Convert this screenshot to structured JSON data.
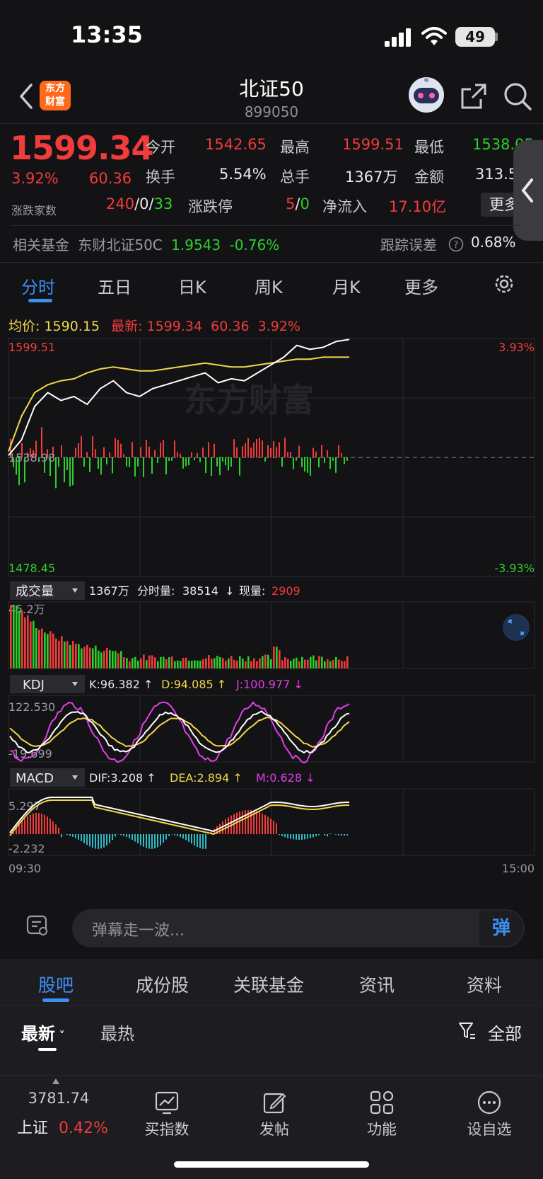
{
  "status_bar": {
    "time": "13:35",
    "battery": "49"
  },
  "header": {
    "logo": "东方\n财富",
    "title": "北证50",
    "code": "899050"
  },
  "quote": {
    "price": "1599.34",
    "change_pct": "3.92%",
    "change": "60.36",
    "open_label": "今开",
    "open": "1542.65",
    "high_label": "最高",
    "high": "1599.51",
    "low_label": "最低",
    "low": "1538.05",
    "turnover_label": "换手",
    "turnover": "5.54%",
    "volume_label": "总手",
    "volume": "1367万",
    "amount_label": "金额",
    "amount": "313.5",
    "adv_label": "涨跌家数",
    "adv_up": "240",
    "adv_sep1": "/",
    "adv_flat": "0",
    "adv_sep2": "/",
    "adv_down": "33",
    "limit_label": "涨跌停",
    "limit_up": "5",
    "limit_sep": "/",
    "limit_down": "0",
    "netflow_label": "净流入",
    "netflow": "17.10亿",
    "more": "更多"
  },
  "fund": {
    "label": "相关基金",
    "name": "东财北证50C",
    "price": "1.9543",
    "change": "-0.76%",
    "tracking_label": "跟踪误差",
    "tracking_value": "0.68%"
  },
  "chart_tabs": [
    "分时",
    "五日",
    "日K",
    "周K",
    "月K",
    "更多"
  ],
  "chart_data": {
    "type": "line",
    "series": [
      {
        "name": "最新",
        "values": [
          1540,
          1548,
          1565,
          1572,
          1568,
          1570,
          1566,
          1574,
          1578,
          1572,
          1570,
          1574,
          1576,
          1578,
          1580,
          1582,
          1577,
          1579,
          1578,
          1582,
          1586,
          1590,
          1596,
          1594,
          1595,
          1598,
          1599
        ]
      },
      {
        "name": "均价",
        "values": [
          1542,
          1560,
          1572,
          1576,
          1578,
          1579,
          1582,
          1584,
          1585,
          1584,
          1583,
          1583,
          1584,
          1585,
          1586,
          1587,
          1586,
          1585,
          1585,
          1586,
          1587,
          1588,
          1589,
          1589,
          1590,
          1590,
          1590
        ]
      }
    ],
    "ylim": [
      1478.45,
      1599.51
    ],
    "y_top_label": "1599.51",
    "y_mid_label": "1538.98",
    "y_bottom_label": "1478.45",
    "pct_top_label": "3.93%",
    "pct_bottom_label": "-3.93%",
    "x_start_label": "09:30",
    "x_end_label": "15:00",
    "watermark": "东方财富"
  },
  "chart_header": {
    "avg_label": "均价:",
    "avg_value": "1590.15",
    "latest_label": "最新:",
    "latest_value": "1599.34",
    "latest_change": "60.36",
    "latest_pct": "3.92%"
  },
  "volume_panel": {
    "selector": "成交量",
    "total": "1367万",
    "minute_label": "分时量:",
    "minute_value": "38514",
    "arrow": "↓",
    "current_label": "现量:",
    "current_value": "2909",
    "max_label": "45.2万"
  },
  "kdj_panel": {
    "selector": "KDJ",
    "k": "K:96.382 ↑",
    "d": "D:94.085 ↑",
    "j": "J:100.977 ↓",
    "max_label": "122.530",
    "min_label": "-19.699"
  },
  "macd_panel": {
    "selector": "MACD",
    "dif": "DIF:3.208 ↑",
    "dea": "DEA:2.894 ↑",
    "m": "M:0.628 ↓",
    "max_label": "5.297",
    "min_label": "-2.232"
  },
  "comment": {
    "placeholder": "弹幕走一波...",
    "danmu": "弹"
  },
  "bottom_tabs": [
    "股吧",
    "成份股",
    "关联基金",
    "资讯",
    "资料"
  ],
  "sort": {
    "newest": "最新",
    "hot": "最热",
    "filter": "全部"
  },
  "bottom_nav": {
    "index_value": "3781.74",
    "index_name": "上证",
    "index_pct": "0.42%",
    "items": [
      "买指数",
      "发帖",
      "功能",
      "设自选"
    ]
  },
  "colors": {
    "up": "#f23b3b",
    "down": "#2bd02b",
    "accent": "#3b8ff0",
    "avg_line": "#f2d74a",
    "background": "#131316"
  }
}
